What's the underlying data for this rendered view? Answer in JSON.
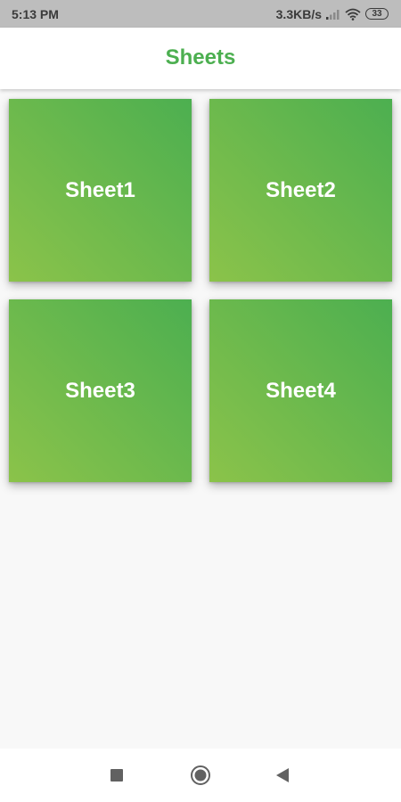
{
  "status_bar": {
    "time": "5:13 PM",
    "network_speed": "3.3KB/s",
    "battery_level": "33",
    "icons": [
      "signal-icon",
      "wifi-icon",
      "battery-icon"
    ]
  },
  "app_bar": {
    "title": "Sheets"
  },
  "sheets": [
    {
      "label": "Sheet1"
    },
    {
      "label": "Sheet2"
    },
    {
      "label": "Sheet3"
    },
    {
      "label": "Sheet4"
    }
  ],
  "nav_bar": {
    "icons": [
      "recents-square-icon",
      "home-circle-icon",
      "back-triangle-icon"
    ]
  },
  "colors": {
    "accent": "#4caf50",
    "tile_gradient_start": "#8bc34a",
    "tile_gradient_end": "#4caf50",
    "status_bar_bg": "#bdbdbd",
    "background": "#f8f8f8"
  }
}
